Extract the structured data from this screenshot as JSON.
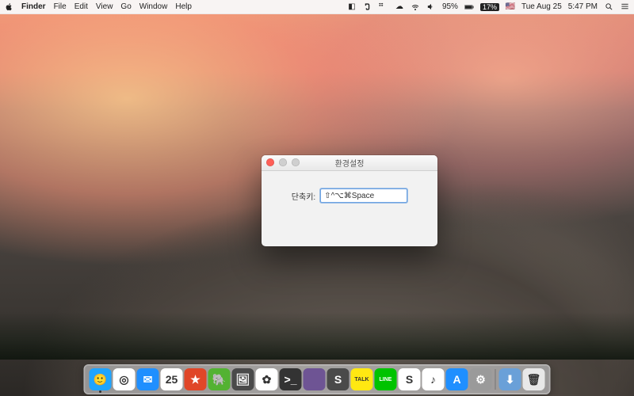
{
  "menubar": {
    "app_name": "Finder",
    "items": [
      "File",
      "Edit",
      "View",
      "Go",
      "Window",
      "Help"
    ],
    "status": {
      "battery_text": "95%",
      "battery_badge": "17%",
      "day_date": "Tue Aug 25",
      "time": "5:47 PM",
      "flag": "🇺🇸"
    }
  },
  "preferences_window": {
    "title": "환경설정",
    "shortcut_label": "단축키:",
    "shortcut_value": "⇧^⌥⌘Space"
  },
  "dock": {
    "apps": [
      {
        "name": "finder",
        "bg": "#1fa4ff",
        "glyph": "🙂"
      },
      {
        "name": "chrome",
        "bg": "#ffffff",
        "glyph": "◎"
      },
      {
        "name": "mail",
        "bg": "#1f8fff",
        "glyph": "✉︎"
      },
      {
        "name": "calendar",
        "bg": "#ffffff",
        "glyph": "25"
      },
      {
        "name": "wunderlist",
        "bg": "#e04628",
        "glyph": "★"
      },
      {
        "name": "evernote",
        "bg": "#53b232",
        "glyph": "🐘"
      },
      {
        "name": "preview",
        "bg": "#4a4a4a",
        "glyph": "🖼"
      },
      {
        "name": "photos",
        "bg": "#ffffff",
        "glyph": "✿"
      },
      {
        "name": "iterm",
        "bg": "#333333",
        "glyph": ">_"
      },
      {
        "name": "github",
        "bg": "#6e5494",
        "glyph": ""
      },
      {
        "name": "sublime",
        "bg": "#4a4a4a",
        "glyph": "S"
      },
      {
        "name": "kakaotalk",
        "bg": "#ffe812",
        "glyph": "TALK"
      },
      {
        "name": "line",
        "bg": "#00c300",
        "glyph": "LINE"
      },
      {
        "name": "slack",
        "bg": "#ffffff",
        "glyph": "S"
      },
      {
        "name": "itunes",
        "bg": "#ffffff",
        "glyph": "♪"
      },
      {
        "name": "appstore",
        "bg": "#1f8fff",
        "glyph": "A"
      },
      {
        "name": "settings",
        "bg": "#9a9a9a",
        "glyph": "⚙︎"
      }
    ],
    "right": [
      {
        "name": "downloads",
        "bg": "#6aa0d8",
        "glyph": "⬇︎"
      },
      {
        "name": "trash",
        "bg": "#e8e8e8",
        "glyph": "🗑"
      }
    ]
  }
}
